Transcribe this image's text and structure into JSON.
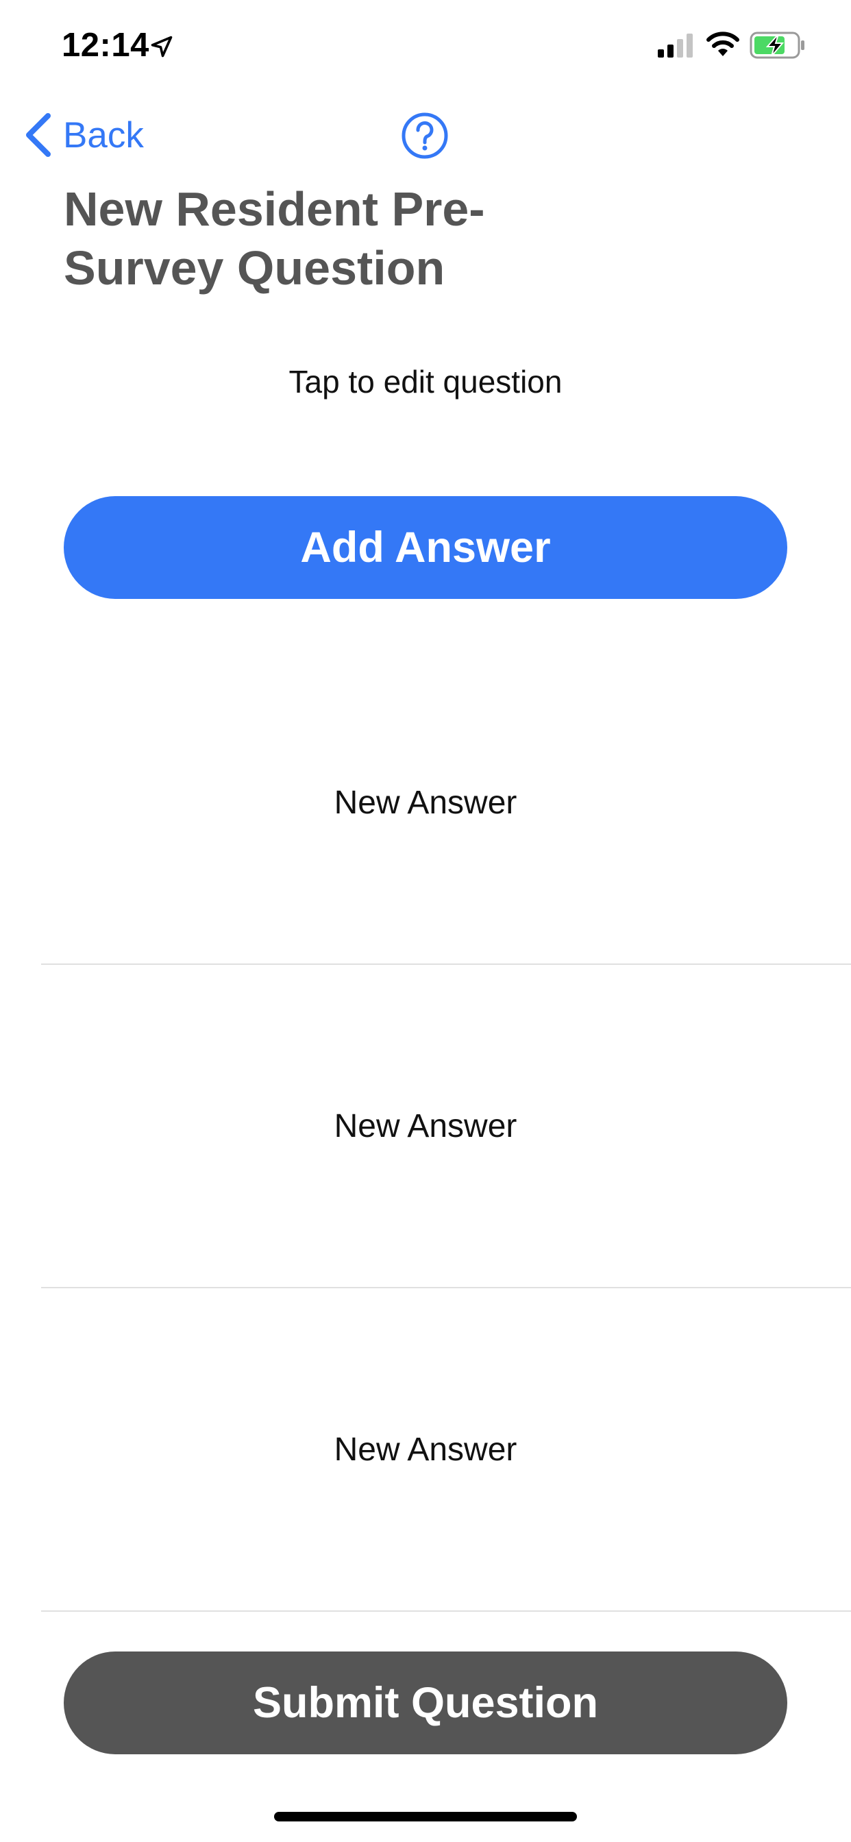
{
  "status_bar": {
    "time": "12:14",
    "location_icon": "location-arrow-icon",
    "signal_icon": "cellular-signal-icon",
    "wifi_icon": "wifi-icon",
    "battery_icon": "battery-charging-icon"
  },
  "nav": {
    "back_label": "Back",
    "back_icon": "chevron-left-icon",
    "help_icon": "question-circle-icon"
  },
  "page": {
    "title": "New Resident Pre-Survey Question",
    "question_placeholder": "Tap to edit question"
  },
  "buttons": {
    "add_answer": "Add Answer",
    "submit": "Submit Question"
  },
  "answers": [
    {
      "label": "New Answer"
    },
    {
      "label": "New Answer"
    },
    {
      "label": "New Answer"
    }
  ],
  "colors": {
    "accent": "#3478f6",
    "title": "#555555",
    "submit_bg": "#555555",
    "battery_fill": "#4cd964"
  }
}
